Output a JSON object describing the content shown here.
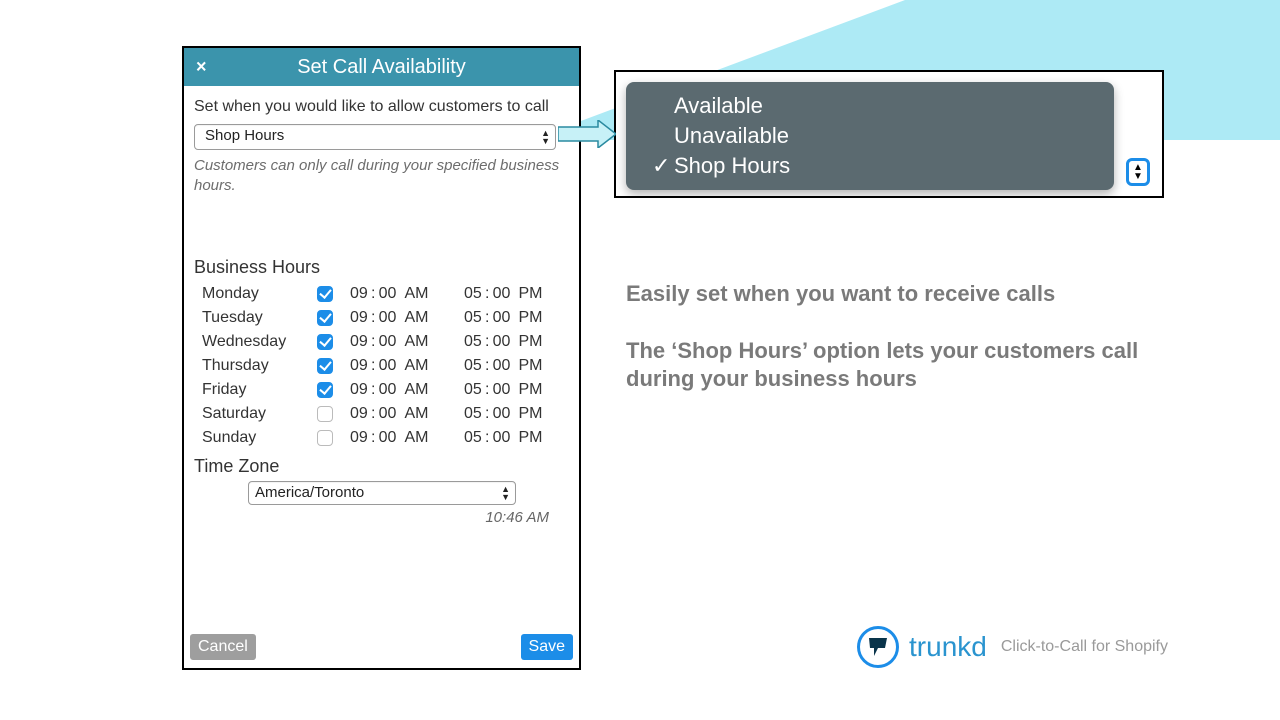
{
  "panel": {
    "title": "Set Call Availability",
    "desc": "Set when you would like to allow customers to call",
    "availability_selected": "Shop Hours",
    "availability_options": [
      "Available",
      "Unavailable",
      "Shop Hours"
    ],
    "hint": "Customers can only call during your specified business hours.",
    "business_hours_title": "Business Hours",
    "days": [
      {
        "name": "Monday",
        "enabled": true,
        "open": "09:00 AM",
        "close": "05:00 PM"
      },
      {
        "name": "Tuesday",
        "enabled": true,
        "open": "09:00 AM",
        "close": "05:00 PM"
      },
      {
        "name": "Wednesday",
        "enabled": true,
        "open": "09:00 AM",
        "close": "05:00 PM"
      },
      {
        "name": "Thursday",
        "enabled": true,
        "open": "09:00 AM",
        "close": "05:00 PM"
      },
      {
        "name": "Friday",
        "enabled": true,
        "open": "09:00 AM",
        "close": "05:00 PM"
      },
      {
        "name": "Saturday",
        "enabled": false,
        "open": "09:00 AM",
        "close": "05:00 PM"
      },
      {
        "name": "Sunday",
        "enabled": false,
        "open": "09:00 AM",
        "close": "05:00 PM"
      }
    ],
    "timezone_title": "Time Zone",
    "timezone_selected": "America/Toronto",
    "current_time": "10:46 AM",
    "cancel_label": "Cancel",
    "save_label": "Save"
  },
  "dropdown": {
    "options": [
      {
        "label": "Available",
        "checked": false
      },
      {
        "label": "Unavailable",
        "checked": false
      },
      {
        "label": "Shop Hours",
        "checked": true
      }
    ]
  },
  "marketing": {
    "line1": "Easily set when you want to receive calls",
    "line2": "The ‘Shop Hours’ option lets your customers call during your business hours"
  },
  "brand": {
    "name": "trunkd",
    "tag": "Click-to-Call for Shopify"
  }
}
